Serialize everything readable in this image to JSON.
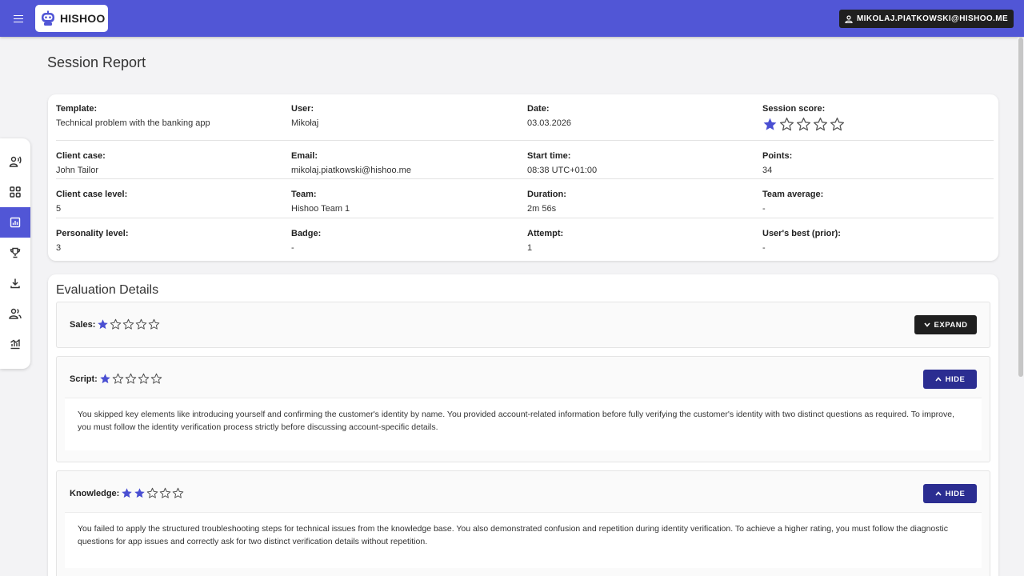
{
  "app": {
    "name": "HISHOO",
    "brand_color": "#5156d6"
  },
  "topbar": {
    "menu_icon": "menu-icon",
    "user_label": "MIKOLAJ.PIATKOWSKI@HISHOO.ME"
  },
  "page": {
    "title": "Session Report"
  },
  "sidebar": {
    "items": [
      {
        "icon": "voice-user-icon",
        "active": false
      },
      {
        "icon": "grid-icon",
        "active": false
      },
      {
        "icon": "report-icon",
        "active": true
      },
      {
        "icon": "trophy-icon",
        "active": false
      },
      {
        "icon": "download-icon",
        "active": false
      },
      {
        "icon": "group-icon",
        "active": false
      },
      {
        "icon": "analytics-icon",
        "active": false
      }
    ]
  },
  "info": {
    "template": {
      "label": "Template:",
      "value": "Technical problem with the banking app"
    },
    "user": {
      "label": "User:",
      "value": "Mikołaj"
    },
    "date": {
      "label": "Date:",
      "value": "03.03.2026"
    },
    "session_score": {
      "label": "Session score:",
      "rating": 1,
      "max": 5
    },
    "client_case": {
      "label": "Client case:",
      "value": "John Tailor"
    },
    "email": {
      "label": "Email:",
      "value": "mikolaj.piatkowski@hishoo.me"
    },
    "start_time": {
      "label": "Start time:",
      "value": "08:38 UTC+01:00"
    },
    "points": {
      "label": "Points:",
      "value": "34"
    },
    "client_case_level": {
      "label": "Client case level:",
      "value": "5"
    },
    "team": {
      "label": "Team:",
      "value": "Hishoo Team 1"
    },
    "duration": {
      "label": "Duration:",
      "value": "2m 56s"
    },
    "team_average": {
      "label": "Team average:",
      "value": "-"
    },
    "personality_level": {
      "label": "Personality level:",
      "value": "3"
    },
    "badge": {
      "label": "Badge:",
      "value": "-"
    },
    "attempt": {
      "label": "Attempt:",
      "value": "1"
    },
    "users_best": {
      "label": "User's best (prior):",
      "value": "-"
    }
  },
  "evaluation": {
    "title": "Evaluation Details",
    "items": [
      {
        "label": "Sales:",
        "rating": 1,
        "max": 5,
        "button": "EXPAND",
        "expanded": false
      },
      {
        "label": "Script:",
        "rating": 1,
        "max": 5,
        "button": "HIDE",
        "expanded": true,
        "text": "You skipped key elements like introducing yourself and confirming the customer's identity by name. You provided account-related information before fully verifying the customer's identity with two distinct questions as required. To improve, you must follow the identity verification process strictly before discussing account-specific details."
      },
      {
        "label": "Knowledge:",
        "rating": 2,
        "max": 5,
        "button": "HIDE",
        "expanded": true,
        "text": "You failed to apply the structured troubleshooting steps for technical issues from the knowledge base. You also demonstrated confusion and repetition during identity verification. To achieve a higher rating, you must follow the diagnostic questions for app issues and correctly ask for two distinct verification details without repetition."
      }
    ]
  },
  "colors": {
    "star_filled": "#4a4fd2",
    "star_empty": "#555555",
    "hide_button": "#2b2d91",
    "expand_button": "#1f1f1f"
  }
}
